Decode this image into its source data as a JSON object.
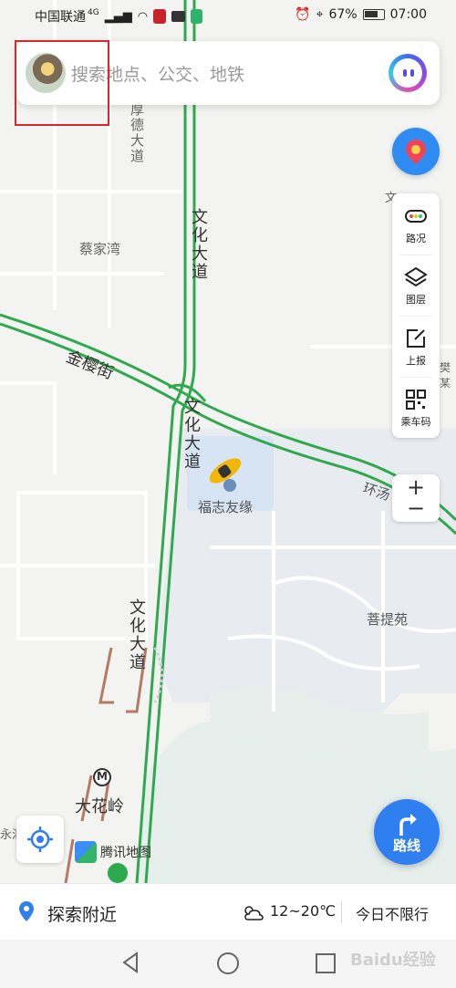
{
  "status_bar": {
    "carrier": "中国联通",
    "network": "4G",
    "battery": "67%",
    "time": "07:00"
  },
  "search": {
    "placeholder": "搜索地点、公交、地铁"
  },
  "tools": [
    {
      "label": "路况",
      "icon": "traffic-icon"
    },
    {
      "label": "图层",
      "icon": "layers-icon"
    },
    {
      "label": "上报",
      "icon": "report-icon"
    },
    {
      "label": "乘车码",
      "icon": "qr-code-icon"
    }
  ],
  "zoom": {
    "in": "+",
    "out": "−"
  },
  "map_labels": {
    "cai_jia_wan": "蔡家湾",
    "jin_ying_jie": "金樱街",
    "fuzhi_youyuan": "福志友缘",
    "puti_yuan": "菩提苑",
    "da_hua_ling": "大花岭",
    "wen_hua_da_dao_top": "文化大道",
    "wen_hua_da_dao_mid": "文化大道",
    "wen_hua_da_dao_bottom": "文化大道",
    "hou_de_da_dao": "厚德大道",
    "huan_road": "环汤",
    "metro_symbol": "M",
    "edge_left": "永汇",
    "edge_right_top": "文",
    "edge_right_mid": "樊某"
  },
  "logo_text": "腾讯地图",
  "route_button": {
    "label": "路线"
  },
  "bottom_bar": {
    "explore": "探索附近",
    "weather": "12~20℃",
    "restriction": "今日不限行"
  },
  "watermark": "Baidu经验",
  "colors": {
    "road_green": "#2fa94e",
    "accent_blue": "#2f7ff0",
    "highlight_red": "#d9272e"
  }
}
